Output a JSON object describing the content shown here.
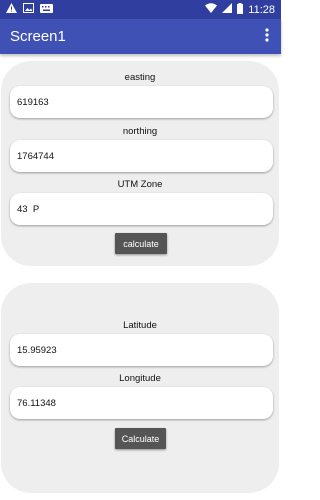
{
  "status_bar": {
    "time": "11:28",
    "icons": [
      "warning-icon",
      "image-icon",
      "keyboard-icon",
      "wifi-icon",
      "signal-icon",
      "battery-icon"
    ]
  },
  "app_bar": {
    "title": "Screen1",
    "overflow_icon": "more-vert-icon",
    "background": "#3F51B5",
    "status_background": "#303F9F"
  },
  "utm_card": {
    "easting_label": "easting",
    "easting_value": "619163",
    "northing_label": "northing",
    "northing_value": "1764744",
    "zone_label": "UTM Zone",
    "zone_value": "43  P",
    "button_label": "calculate"
  },
  "latlon_card": {
    "latitude_label": "Latitude",
    "latitude_value": "15.95923",
    "longitude_label": "Longitude",
    "longitude_value": "76.11348",
    "button_label": "Calculate"
  }
}
